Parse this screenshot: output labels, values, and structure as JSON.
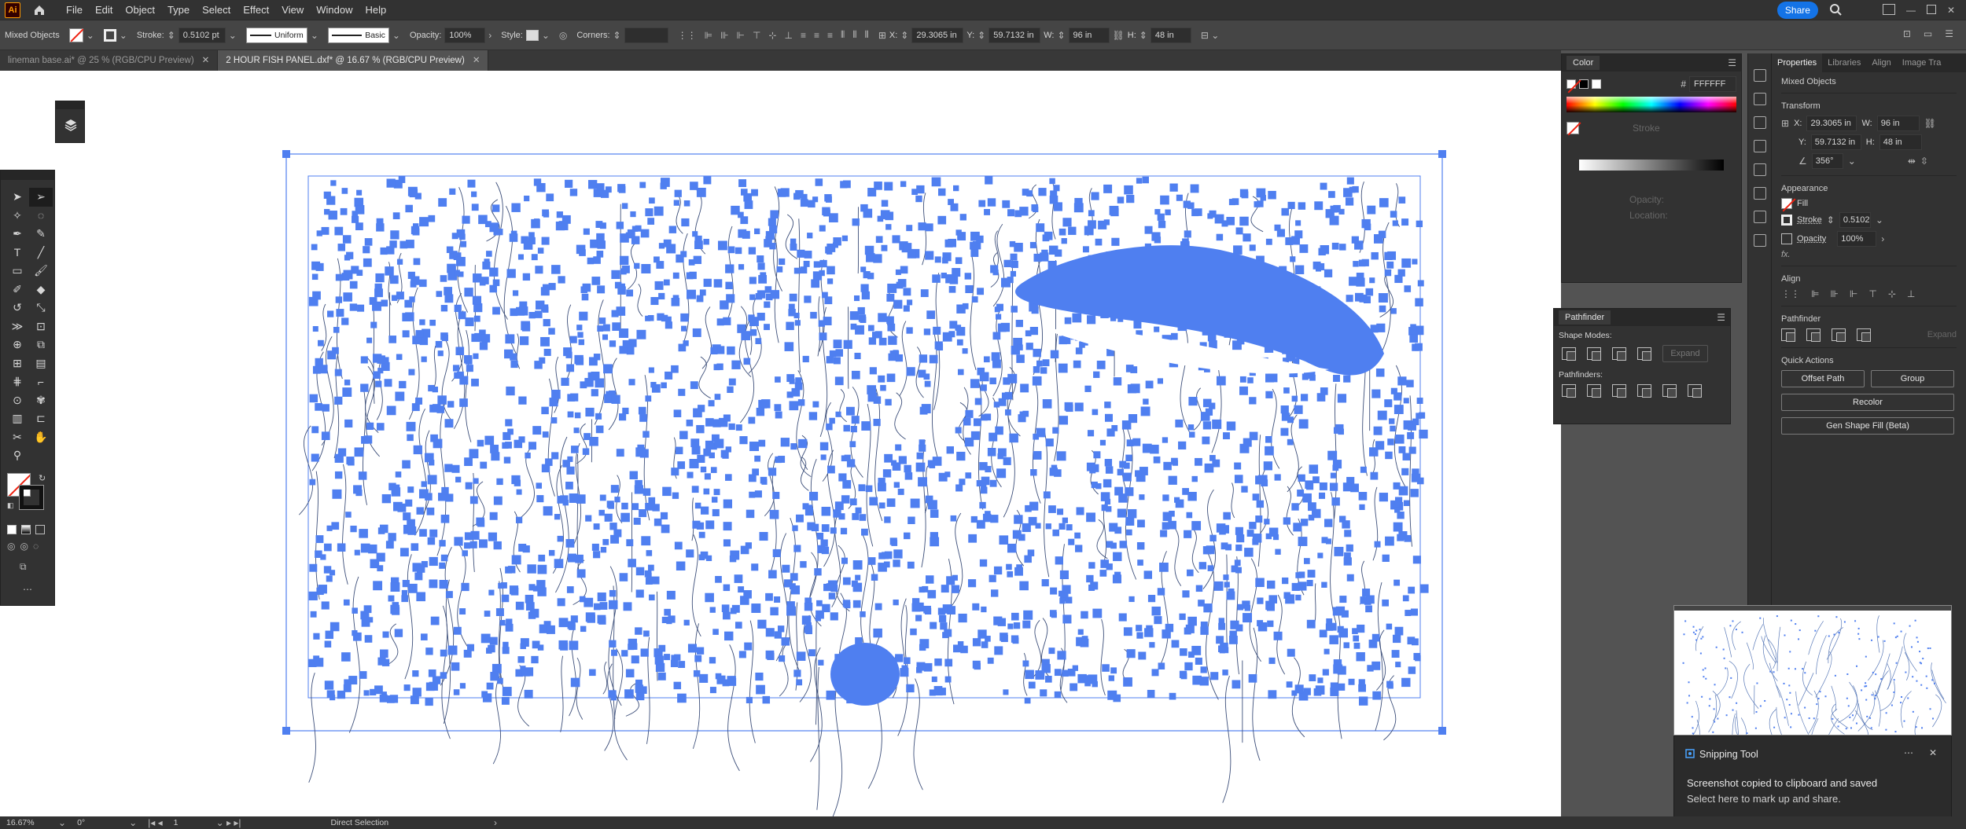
{
  "app": {
    "logo": "Ai"
  },
  "menu": [
    "File",
    "Edit",
    "Object",
    "Type",
    "Select",
    "Effect",
    "View",
    "Window",
    "Help"
  ],
  "topright": {
    "share": "Share"
  },
  "controlbar": {
    "selection": "Mixed Objects",
    "stroke_label": "Stroke:",
    "stroke_value": "0.5102 pt",
    "uniform": "Uniform",
    "basic": "Basic",
    "opacity_label": "Opacity:",
    "opacity_value": "100%",
    "style_label": "Style:",
    "corners_label": "Corners:",
    "x_label": "X:",
    "x_value": "29.3065 in",
    "y_label": "Y:",
    "y_value": "59.7132 in",
    "w_label": "W:",
    "w_value": "96 in",
    "h_label": "H:",
    "h_value": "48 in"
  },
  "tabs": [
    {
      "label": "lineman base.ai* @ 25 % (RGB/CPU Preview)",
      "active": false
    },
    {
      "label": "2 HOUR FISH PANEL.dxf* @ 16.67 % (RGB/CPU Preview)",
      "active": true
    }
  ],
  "color_panel": {
    "title": "Color",
    "hex_label": "#",
    "hex": "FFFFFF",
    "stroke_label": "Stroke",
    "opacity": "Opacity:",
    "location": "Location:"
  },
  "pathfinder_panel": {
    "title": "Pathfinder",
    "shape_modes": "Shape Modes:",
    "expand": "Expand",
    "pathfinders": "Pathfinders:"
  },
  "properties": {
    "tabs": [
      "Properties",
      "Libraries",
      "Align",
      "Image Tra"
    ],
    "selection": "Mixed Objects",
    "transform": "Transform",
    "x_label": "X:",
    "x_value": "29.3065 in",
    "w_label": "W:",
    "w_value": "96 in",
    "y_label": "Y:",
    "y_value": "59.7132 in",
    "h_label": "H:",
    "h_value": "48 in",
    "angle": "356°",
    "appearance": "Appearance",
    "fill": "Fill",
    "stroke": "Stroke",
    "stroke_value": "0.5102",
    "opacity": "Opacity",
    "opacity_value": "100%",
    "fx": "fx.",
    "align": "Align",
    "pathfinder": "Pathfinder",
    "expand": "Expand",
    "quick_actions": "Quick Actions",
    "offset_path": "Offset Path",
    "group": "Group",
    "recolor": "Recolor",
    "gen_shape_fill": "Gen Shape Fill (Beta)"
  },
  "toast": {
    "app": "Snipping Tool",
    "line1": "Screenshot copied to clipboard and saved",
    "line2": "Select here to mark up and share."
  },
  "status": {
    "zoom": "16.67%",
    "rotation": "0°",
    "artboard": "1",
    "tool": "Direct Selection"
  },
  "colors": {
    "art": "#4f7ff0",
    "bg": "#535353",
    "panel": "#323232",
    "accent": "#1473e6"
  }
}
